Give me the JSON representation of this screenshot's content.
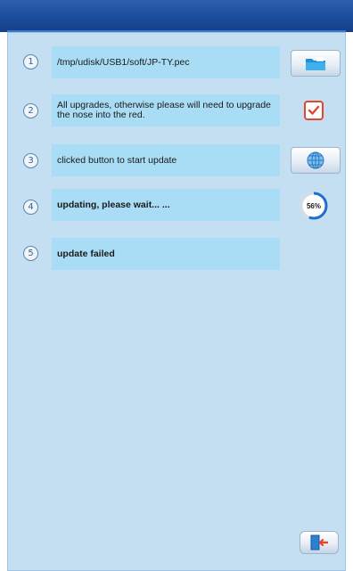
{
  "steps": [
    {
      "number": "1",
      "text": "/tmp/udisk/USB1/soft/JP-TY.pec",
      "action_icon": "folder-icon"
    },
    {
      "number": "2",
      "text": "All upgrades, otherwise please will need to upgrade the nose into the red.",
      "action_icon": "check-icon"
    },
    {
      "number": "3",
      "text": "clicked button to start update",
      "action_icon": "globe-update-icon"
    },
    {
      "number": "4",
      "text": "updating, please wait... ...",
      "progress_label": "56%",
      "progress": 0.56
    },
    {
      "number": "5",
      "text": "update failed"
    }
  ],
  "footer": {
    "exit_icon": "exit-door-icon"
  },
  "colors": {
    "title_bar": "#1b4a9a",
    "panel": "#c5dff2",
    "field": "#a9dcf5",
    "check": "#e2462d",
    "progress": "#1f6fd0"
  }
}
